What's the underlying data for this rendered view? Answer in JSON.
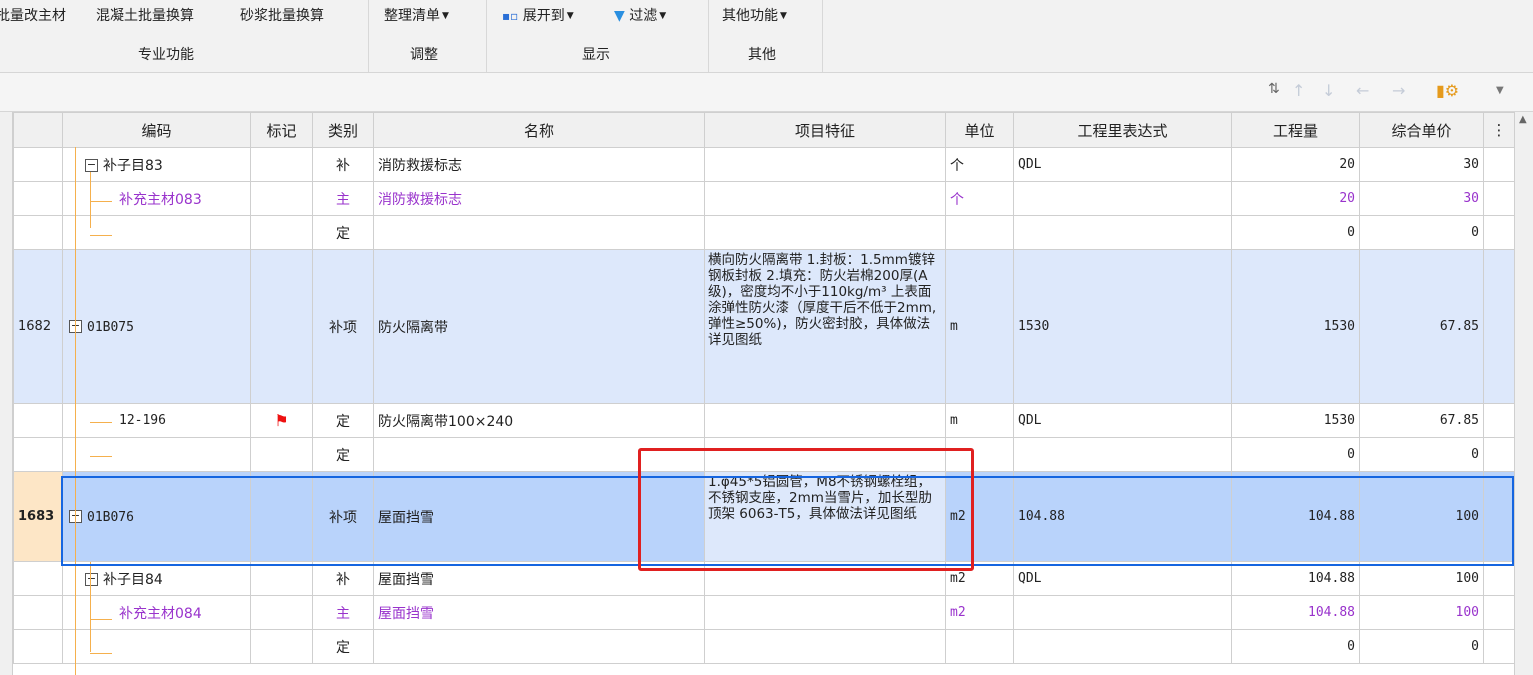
{
  "ribbon": {
    "group1": {
      "buttons": [
        "批量改主材",
        "混凝土批量换算",
        "砂浆批量换算"
      ],
      "label": "专业功能"
    },
    "group2": {
      "buttons": [
        "整理清单"
      ],
      "label": "调整"
    },
    "group3": {
      "buttons": [
        "展开到",
        "过滤"
      ],
      "label": "显示"
    },
    "group4": {
      "buttons": [
        "其他功能"
      ],
      "label": "其他"
    }
  },
  "toolbar": {
    "icons": [
      "sort-icon",
      "move-up-icon",
      "move-down-icon",
      "move-left-icon",
      "move-right-icon",
      "settings-icon"
    ]
  },
  "columns": [
    "",
    "编码",
    "标记",
    "类别",
    "名称",
    "项目特征",
    "单位",
    "工程里表达式",
    "工程量",
    "综合单价"
  ],
  "rows": [
    {
      "num": "",
      "code": "补子目83",
      "mark": "",
      "type": "补",
      "name": "消防救援标志",
      "feature": "",
      "unit": "个",
      "expr": "QDL",
      "qty": "20",
      "price": "30"
    },
    {
      "num": "",
      "code": "补充主材083",
      "mark": "",
      "type": "主",
      "name": "消防救援标志",
      "feature": "",
      "unit": "个",
      "expr": "",
      "qty": "20",
      "price": "30"
    },
    {
      "num": "",
      "code": "",
      "mark": "",
      "type": "定",
      "name": "",
      "feature": "",
      "unit": "",
      "expr": "",
      "qty": "0",
      "price": "0"
    },
    {
      "num": "1682",
      "code": "01B075",
      "mark": "",
      "type": "补项",
      "name": "防火隔离带",
      "feature": "横向防火隔离带\n1.封板：1.5mm镀锌钢板封板\n2.填充：防火岩棉200厚(A级)，密度均不小于110kg/m³\n上表面涂弹性防火漆（厚度干后不低于2mm,弹性≥50%)，防火密封胶，具体做法详见图纸",
      "unit": "m",
      "expr": "1530",
      "qty": "1530",
      "price": "67.85"
    },
    {
      "num": "",
      "code": "12-196",
      "mark": "flag",
      "type": "定",
      "name": "防火隔离带100×240",
      "feature": "",
      "unit": "m",
      "expr": "QDL",
      "qty": "1530",
      "price": "67.85"
    },
    {
      "num": "",
      "code": "",
      "mark": "",
      "type": "定",
      "name": "",
      "feature": "",
      "unit": "",
      "expr": "",
      "qty": "0",
      "price": "0"
    },
    {
      "num": "1683",
      "code": "01B076",
      "mark": "",
      "type": "补项",
      "name": "屋面挡雪",
      "feature": "1.φ45*5铝圆管，M8不锈钢螺栓组，不锈钢支座，2mm当雪片，加长型肋顶架 6063-T5，具体做法详见图纸",
      "unit": "m2",
      "expr": "104.88",
      "qty": "104.88",
      "price": "100"
    },
    {
      "num": "",
      "code": "补子目84",
      "mark": "",
      "type": "补",
      "name": "屋面挡雪",
      "feature": "",
      "unit": "m2",
      "expr": "QDL",
      "qty": "104.88",
      "price": "100"
    },
    {
      "num": "",
      "code": "补充主材084",
      "mark": "",
      "type": "主",
      "name": "屋面挡雪",
      "feature": "",
      "unit": "m2",
      "expr": "",
      "qty": "104.88",
      "price": "100"
    },
    {
      "num": "",
      "code": "",
      "mark": "",
      "type": "定",
      "name": "",
      "feature": "",
      "unit": "",
      "expr": "",
      "qty": "0",
      "price": "0"
    }
  ]
}
